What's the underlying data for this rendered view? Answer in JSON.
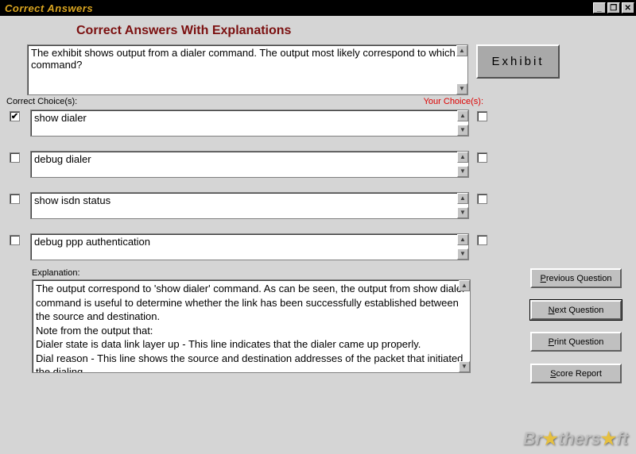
{
  "window": {
    "title": "Correct Answers",
    "min": "_",
    "max": "❐",
    "close": "✕"
  },
  "heading": "Correct Answers With Explanations",
  "question": "The exhibit shows output from a dialer command. The output most likely correspond to which command?",
  "exhibit_label": "Exhibit",
  "labels": {
    "correct": "Correct Choice(s):",
    "your": "Your Choice(s):"
  },
  "choices": [
    {
      "text": "show dialer",
      "correct": true,
      "your": false
    },
    {
      "text": "debug dialer",
      "correct": false,
      "your": false
    },
    {
      "text": "show isdn status",
      "correct": false,
      "your": false
    },
    {
      "text": "debug ppp authentication",
      "correct": false,
      "your": false
    }
  ],
  "explanation_label": "Explanation:",
  "explanation": "The output correspond to 'show dialer' command. As can be seen, the output from show dialer command is useful to determine whether the link has been successfully established between the source and destination.\nNote from the output that:\nDialer state is data link layer up - This line indicates that the dialer came up properly.\nDial reason -  This line shows the source and destination addresses of the packet that initiated the dialing",
  "buttons": {
    "prev": "Previous Question",
    "next": "Next Question",
    "print": "Print Question",
    "score": "Score Report"
  },
  "watermark": {
    "a": "Br",
    "b": "thers",
    "c": "ft"
  }
}
